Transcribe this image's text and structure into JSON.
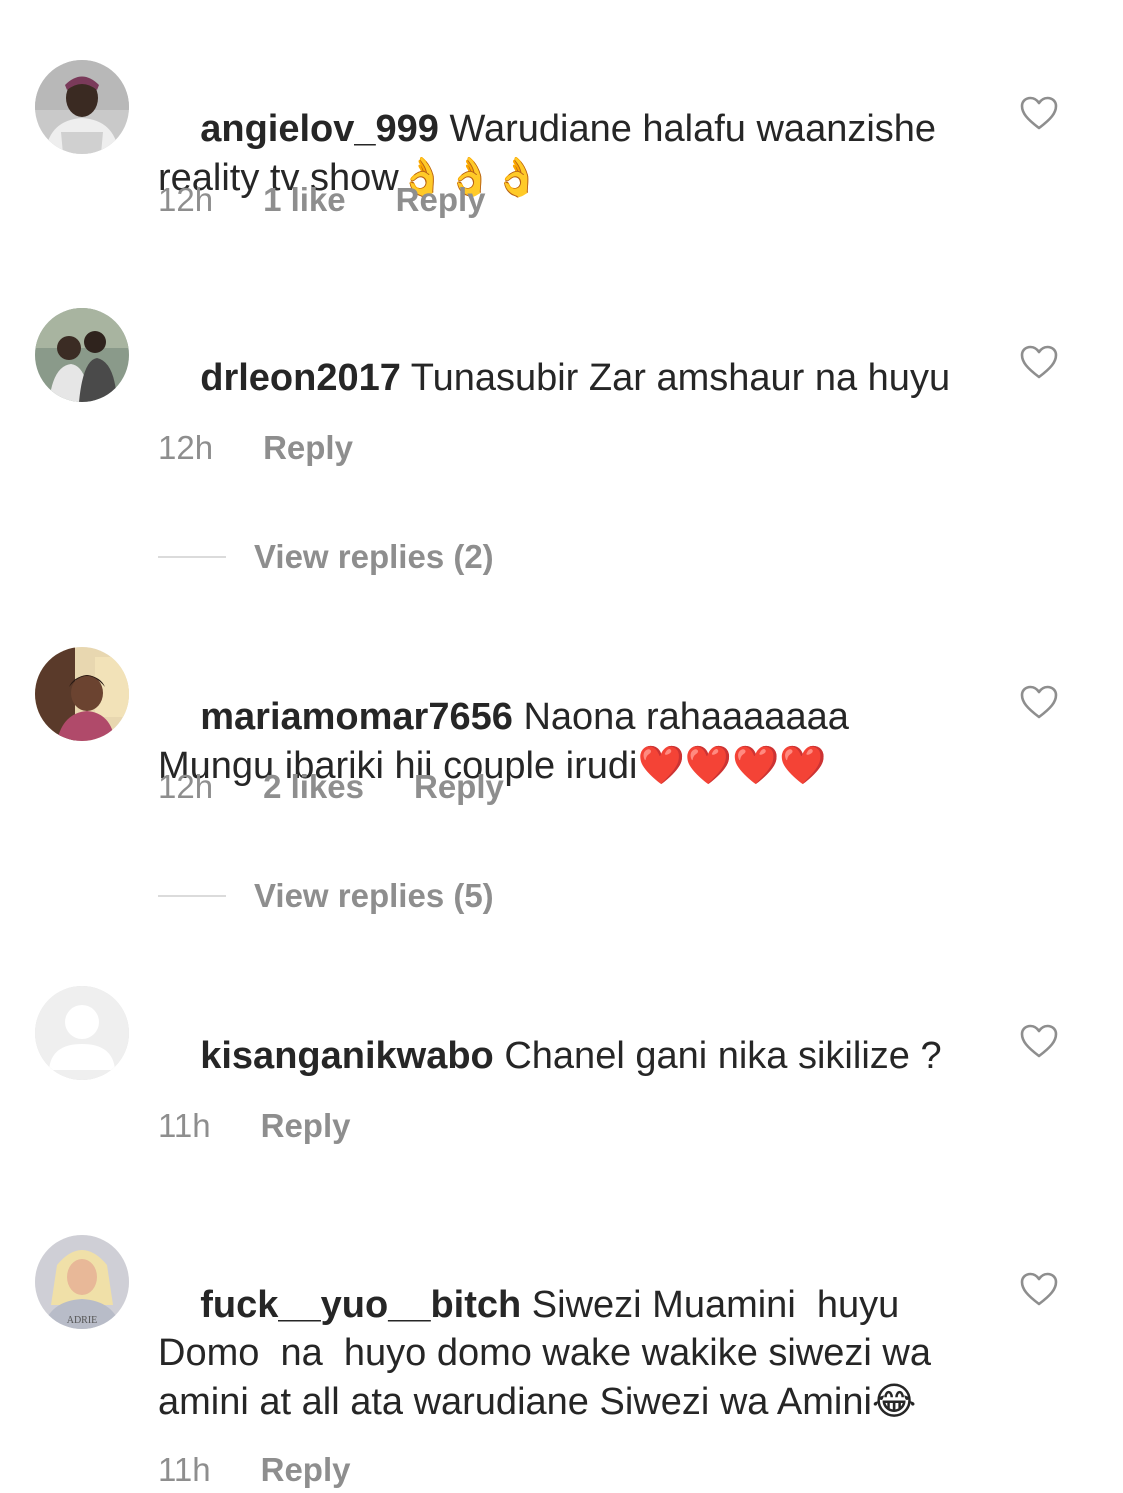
{
  "colors": {
    "text": "#262626",
    "meta": "#8e8e8e",
    "divider": "#dbdbdb"
  },
  "comments": [
    {
      "username": "angielov_999",
      "text": "Warudiane halafu waanzishe reality tv show",
      "emoji": "👌👌👌",
      "time": "12h",
      "likes": "1 like",
      "reply": "Reply",
      "avatar_icon": "profile-photo"
    },
    {
      "username": "drleon2017",
      "text": "Tunasubir Zar amshaur na huyu",
      "emoji": "",
      "time": "12h",
      "likes": "",
      "reply": "Reply",
      "view_replies": "View replies (2)",
      "avatar_icon": "profile-photo"
    },
    {
      "username": "mariamomar7656",
      "text": "Naona rahaaaaaaa Mungu ibariki hii couple irudi",
      "emoji": "❤️❤️❤️❤️",
      "time": "12h",
      "likes": "2 likes",
      "reply": "Reply",
      "view_replies": "View replies (5)",
      "avatar_icon": "profile-photo"
    },
    {
      "username": "kisanganikwabo",
      "text": "Chanel gani nika sikilize ?",
      "emoji": "",
      "time": "11h",
      "likes": "",
      "reply": "Reply",
      "avatar_icon": "default-avatar-icon"
    },
    {
      "username": "fuck__yuo__bitch",
      "text": "Siwezi Muamini  huyu Domo  na  huyo domo wake wakike siwezi wa amini at all ata warudiane Siwezi wa Amini",
      "emoji": "😂",
      "time": "11h",
      "likes": "",
      "reply": "Reply",
      "avatar_icon": "profile-photo"
    }
  ]
}
